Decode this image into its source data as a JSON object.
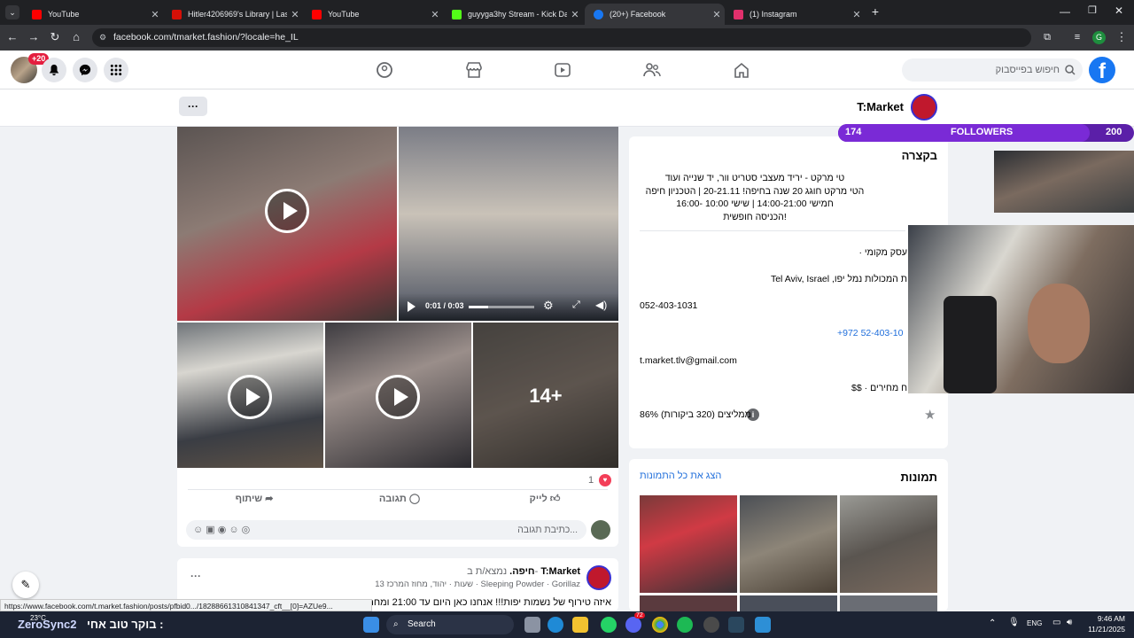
{
  "browser": {
    "tabs": [
      {
        "title": "YouTube",
        "color": "#ff0000"
      },
      {
        "title": "Hitler4206969's Library | Last.fm",
        "color": "#d51007"
      },
      {
        "title": "YouTube",
        "color": "#ff0000"
      },
      {
        "title": "guyyga3hy Stream - Kick Dashb",
        "color": "#53fc18"
      },
      {
        "title": "(20+) Facebook",
        "color": "#1877f2"
      },
      {
        "title": "(1) Instagram",
        "color": "#e1306c"
      }
    ],
    "new_tab": "+",
    "url": "facebook.com/tmarket.fashion/?locale=he_IL",
    "status_url": "https://www.facebook.com/t.market.fashion/posts/pfbid0.../18288661310841347_cft__[0]=AZUe9...",
    "profile_initial": "G"
  },
  "fb": {
    "notif_badge": "+20",
    "search_placeholder": "חיפוש בפייסבוק",
    "brand_color": "#1877f2",
    "page_name": "T:Market",
    "more": "···",
    "about": {
      "title": "בקצרה",
      "lines": [
        "טי מרקט - יריד מעצבי סטריט וור, יד שנייה ועוד",
        "הטי מרקט חוגג 20 שנה בחיפה! 20-21.11 | הטכניון חיפה",
        "חמישי 14:00-21:00 | שישי 10:00 -16:00",
        "הכניסה חופשית!"
      ],
      "category": "· עסק מקומי",
      "address": "Tel Aviv, Israel ,ת המכולות נמל יפו",
      "phone": "052-403-1031",
      "phone_intl": "+972 52-403-10",
      "email": "t.market.tlv@gmail.com",
      "price": "$$ · ח מחירים",
      "rating": "86% ממליצים (320 ביקורות)"
    },
    "photos": {
      "title": "תמונות",
      "see_all": "הצג את כל התמונות"
    },
    "post": {
      "video_time": "0:01 / 0:03",
      "more_count": "14+",
      "reactions": "1",
      "like": "לייק",
      "comment": "תגובה",
      "share": "שיתוף",
      "comment_placeholder": "כתיבת תגובה...",
      "author": "T:Market",
      "author_suffix": "נמצא/ת ב-",
      "location": "חיפה.",
      "meta": "13 שעות · יהוד, מחוז המרכז · Sleeping Powder · Gorillaz",
      "text_preview": "איזה טירוף של נשמות יפות!!! אנחנו כאן היום עד 21:00 ומחר מ"
    }
  },
  "stream": {
    "followers_current": "174",
    "followers_label": "FOLLOWERS",
    "followers_goal": "200",
    "progress": 0.87,
    "caption": "בוקר טוב אחי :",
    "brand": "ZeroSync2"
  },
  "taskbar": {
    "weather": "23°C",
    "search": "Search",
    "lang": "ENG",
    "time": "9:46 AM",
    "date": "11/21/2025",
    "badge": "72"
  }
}
